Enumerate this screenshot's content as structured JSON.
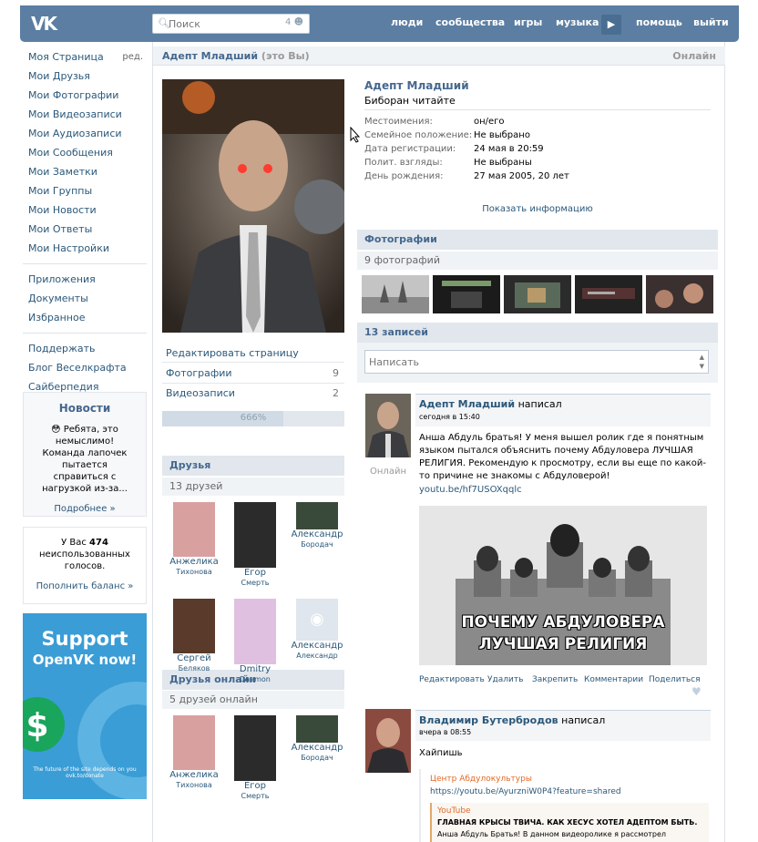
{
  "header": {
    "logo": "VK",
    "search_placeholder": "Поиск",
    "search_count": "4",
    "nav": [
      "люди",
      "сообщества",
      "игры",
      "музыка",
      "помощь",
      "выйти"
    ]
  },
  "leftmenu": {
    "items": [
      "Моя Страница",
      "Мои Друзья",
      "Мои Фотографии",
      "Мои Видеозаписи",
      "Мои Аудиозаписи",
      "Мои Сообщения",
      "Мои Заметки",
      "Мои Группы",
      "Мои Новости",
      "Мои Ответы",
      "Мои Настройки"
    ],
    "edit": "ред.",
    "items2": [
      "Приложения",
      "Документы",
      "Избранное"
    ],
    "items3": [
      "Поддержать",
      "Блог Веселкрафта",
      "Сайберпедия"
    ]
  },
  "news": {
    "title": "Новости",
    "text": "😳 Ребята, это немыслимо! Команда лапочек пытается справиться с нагрузкой из-за...",
    "more": "Подробнее »"
  },
  "votes": {
    "pre": "У Вас",
    "count": "474",
    "post": "неиспользованных голосов.",
    "link": "Пополнить баланс »"
  },
  "banner": {
    "l1": "Support",
    "l2": "OpenVK now!",
    "foot1": "The future of the site depends on you",
    "foot2": "ovk.to/donate"
  },
  "profile": {
    "name": "Адепт Младший",
    "you": "(это Вы)",
    "online": "Онлайн",
    "status": "Биборан читайте",
    "info": [
      [
        "Местоимения:",
        "он/его"
      ],
      [
        "Семейное положение:",
        "Не выбрано"
      ],
      [
        "Дата регистрации:",
        "24 мая в 20:59"
      ],
      [
        "Полит. взгляды:",
        "Не выбраны"
      ],
      [
        "День рождения:",
        "27 мая 2005, 20 лет"
      ]
    ],
    "show_info": "Показать информацию",
    "edit_page": "Редактировать страницу",
    "photos_label": "Фотографии",
    "photos_count": "9",
    "videos_label": "Видеозаписи",
    "videos_count": "2",
    "rating": "666%"
  },
  "friends": {
    "title": "Друзья",
    "count": "13 друзей",
    "list": [
      [
        "Анжелика",
        "Тихонова"
      ],
      [
        "Егор",
        "Смерть"
      ],
      [
        "Александр",
        "Бородач"
      ],
      [
        "Сергей",
        "Беляков"
      ],
      [
        "Dmitry",
        "Daemon"
      ],
      [
        "Александр",
        "Александр"
      ]
    ]
  },
  "online_friends": {
    "title": "Друзья онлайн",
    "count": "5 друзей онлайн",
    "list": [
      [
        "Анжелика",
        "Тихонова"
      ],
      [
        "Егор",
        "Смерть"
      ],
      [
        "Александр",
        "Бородач"
      ]
    ]
  },
  "photos": {
    "title": "Фотографии",
    "count": "9 фотографий"
  },
  "wall": {
    "title": "13 записей",
    "placeholder": "Написать"
  },
  "post1": {
    "author": "Адепт Младший",
    "wrote": "написал",
    "date": "сегодня в 15:40",
    "online": "Онлайн",
    "text": "Анша Абдуль братья! У меня вышел ролик где я понятным языком пытался объяснить почему Абдуловера ЛУЧШАЯ РЕЛИГИЯ. Рекомендую к просмотру, если вы еще по какой-то причине не знакомы с Абдуловерой!",
    "link": "youtu.be/hf7USOXqqlc",
    "img1": "ПОЧЕМУ АБДУЛОВЕРА",
    "img2": "ЛУЧШАЯ РЕЛИГИЯ",
    "actions": [
      "Редактировать",
      "Удалить",
      "Закрепить",
      "Комментарии",
      "Поделиться"
    ]
  },
  "post2": {
    "author": "Владимир Бутербродов",
    "wrote": "написал",
    "date": "вчера в 08:55",
    "text": "Хайпишь",
    "repost_name": "Центр Абдулокультуры",
    "repost_link": "https://youtu.be/AyurzniW0P4?feature=shared",
    "yt_label": "YouTube",
    "yt_title": "ГЛАВНАЯ КРЫСЫ ТВИЧА. КАК ХЕСУС ХОТЕЛ АДЕПТОМ БЫТЬ.",
    "yt_text": "Анша Абдуль Братья! В данном видеоролике я рассмотрел"
  }
}
